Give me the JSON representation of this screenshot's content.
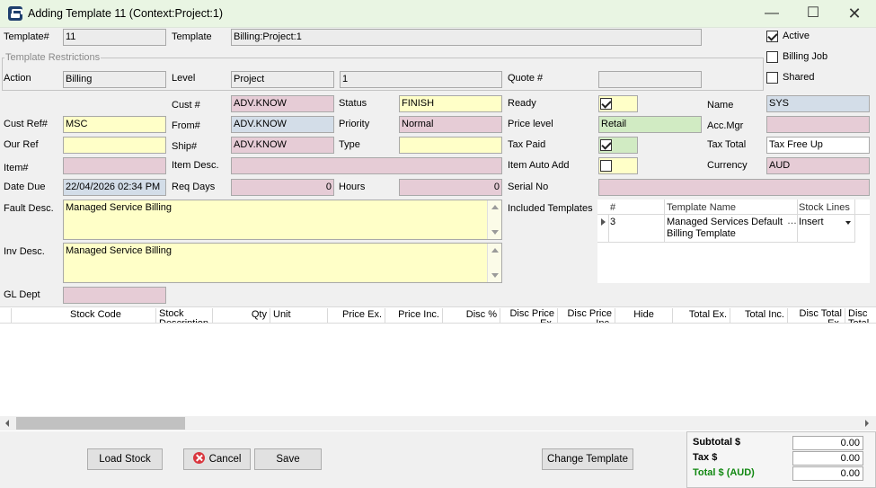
{
  "window": {
    "title": "Adding Template 11 (Context:Project:1)",
    "minimize_icon": "minimize-icon",
    "maximize_icon": "maximize-icon",
    "close_icon": "close-icon"
  },
  "header": {
    "template_num_label": "Template#",
    "template_num": "11",
    "template_label": "Template",
    "template_value": "Billing:Project:1",
    "active_label": "Active",
    "active_checked": true,
    "billing_job_label": "Billing Job",
    "billing_job_checked": false,
    "shared_label": "Shared",
    "shared_checked": false
  },
  "restrictions": {
    "group_title": "Template Restrictions",
    "action_label": "Action",
    "action_value": "Billing",
    "level_label": "Level",
    "level_value": "Project",
    "level_id": "1",
    "quote_label": "Quote #",
    "quote_value": ""
  },
  "details": {
    "cust_num_label": "Cust #",
    "cust_num": "ADV.KNOW",
    "status_label": "Status",
    "status": "FINISH",
    "ready_label": "Ready",
    "ready_checked": true,
    "name_label": "Name",
    "name": "SYS",
    "cust_ref_label": "Cust Ref#",
    "cust_ref": "MSC",
    "from_label": "From#",
    "from": "ADV.KNOW",
    "priority_label": "Priority",
    "priority": "Normal",
    "price_level_label": "Price level",
    "price_level": "Retail",
    "acc_mgr_label": "Acc.Mgr",
    "acc_mgr": "",
    "our_ref_label": "Our Ref",
    "our_ref": "",
    "ship_label": "Ship#",
    "ship": "ADV.KNOW",
    "type_label": "Type",
    "type": "",
    "tax_paid_label": "Tax Paid",
    "tax_paid_checked": true,
    "tax_total_label": "Tax Total",
    "tax_total": "Tax Free Up",
    "item_label": "Item#",
    "item": "",
    "item_desc_label": "Item Desc.",
    "item_desc": "",
    "item_auto_add_label": "Item Auto Add",
    "item_auto_add_checked": false,
    "currency_label": "Currency",
    "currency": "AUD",
    "date_due_label": "Date Due",
    "date_due": "22/04/2026 02:34 PM",
    "req_days_label": "Req Days",
    "req_days": "0",
    "hours_label": "Hours",
    "hours": "0",
    "serial_no_label": "Serial No",
    "serial_no": "",
    "fault_desc_label": "Fault Desc.",
    "fault_desc": "Managed Service Billing",
    "inv_desc_label": "Inv Desc.",
    "inv_desc": "Managed Service Billing",
    "gl_dept_label": "GL Dept",
    "gl_dept": ""
  },
  "included_templates": {
    "label": "Included Templates",
    "columns": [
      "#",
      "Template Name",
      "Stock Lines"
    ],
    "rows": [
      {
        "num": "3",
        "name_line1": "Managed Services Default",
        "name_line2": "Billing Template",
        "stock_lines": "Insert"
      }
    ]
  },
  "stock_grid": {
    "columns": [
      "Stock Code",
      "Stock Description",
      "Qty",
      "Unit",
      "Price Ex.",
      "Price Inc.",
      "Disc %",
      "Disc Price Ex.",
      "Disc Price Inc.",
      "Hide",
      "Total Ex.",
      "Total Inc.",
      "Disc Total Ex.",
      "Disc Total Inc."
    ]
  },
  "buttons": {
    "load_stock": "Load Stock",
    "cancel": "Cancel",
    "save": "Save",
    "change_template": "Change Template"
  },
  "totals": {
    "subtotal_label": "Subtotal $",
    "subtotal": "0.00",
    "tax_label": "Tax $",
    "tax": "0.00",
    "total_label": "Total $ (AUD)",
    "total": "0.00",
    "total_label_color": "#118811"
  },
  "colors": {
    "pink_field": "#e6ccd6",
    "yellow_field": "#ffffc8",
    "blue_field": "#d3dde8",
    "green_field": "#d1ebc3",
    "titlebar": "#e9f5e3"
  }
}
